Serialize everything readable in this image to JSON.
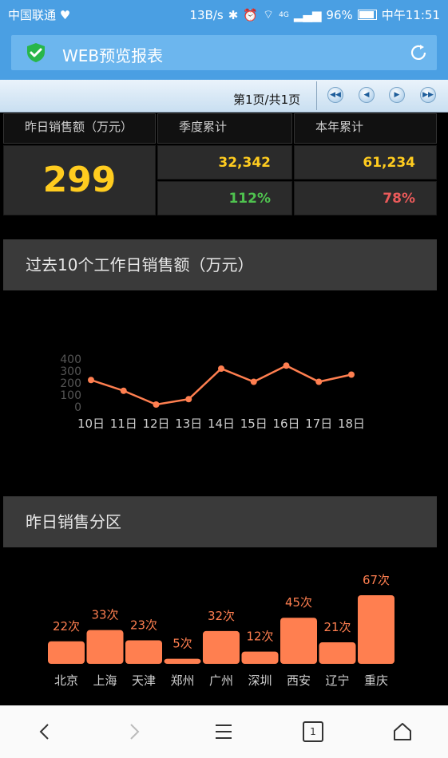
{
  "status_bar": {
    "carrier": "中国联通",
    "speed": "13B/s",
    "network": "4G",
    "battery": "96%",
    "time": "中午11:51"
  },
  "app": {
    "title": "WEB预览报表"
  },
  "pager": {
    "page_text": "第1页/共1页"
  },
  "kpi": {
    "yesterday_label": "昨日销售额（万元）",
    "quarter_label": "季度累计",
    "year_label": "本年累计",
    "yesterday_value": "299",
    "quarter_total": "32,342",
    "quarter_pct": "112%",
    "year_total": "61,234",
    "year_pct": "78%"
  },
  "colors": {
    "accent_yellow": "#ffcc1f",
    "green": "#4fc24f",
    "red": "#ea5a5a",
    "chart_orange": "#ff7f50",
    "header_blue": "#4a9fe3"
  },
  "section1": {
    "title": "过去10个工作日销售额（万元）"
  },
  "section2": {
    "title": "昨日销售分区"
  },
  "chart_data": [
    {
      "type": "line",
      "categories": [
        "10日",
        "11日",
        "12日",
        "13日",
        "14日",
        "15日",
        "16日",
        "17日",
        "18日"
      ],
      "values": [
        225,
        135,
        20,
        65,
        320,
        210,
        345,
        210,
        270
      ],
      "yticks": [
        "0",
        "100",
        "200",
        "300",
        "400"
      ],
      "ylim": [
        0,
        400
      ],
      "grid": false
    },
    {
      "type": "bar",
      "categories": [
        "北京",
        "上海",
        "天津",
        "郑州",
        "广州",
        "深圳",
        "西安",
        "辽宁",
        "重庆"
      ],
      "values": [
        22,
        33,
        23,
        5,
        32,
        12,
        45,
        21,
        67
      ],
      "data_labels": [
        "22次",
        "33次",
        "23次",
        "5次",
        "32次",
        "12次",
        "45次",
        "21次",
        "67次"
      ]
    }
  ],
  "nav": {
    "tab_count": "1"
  }
}
